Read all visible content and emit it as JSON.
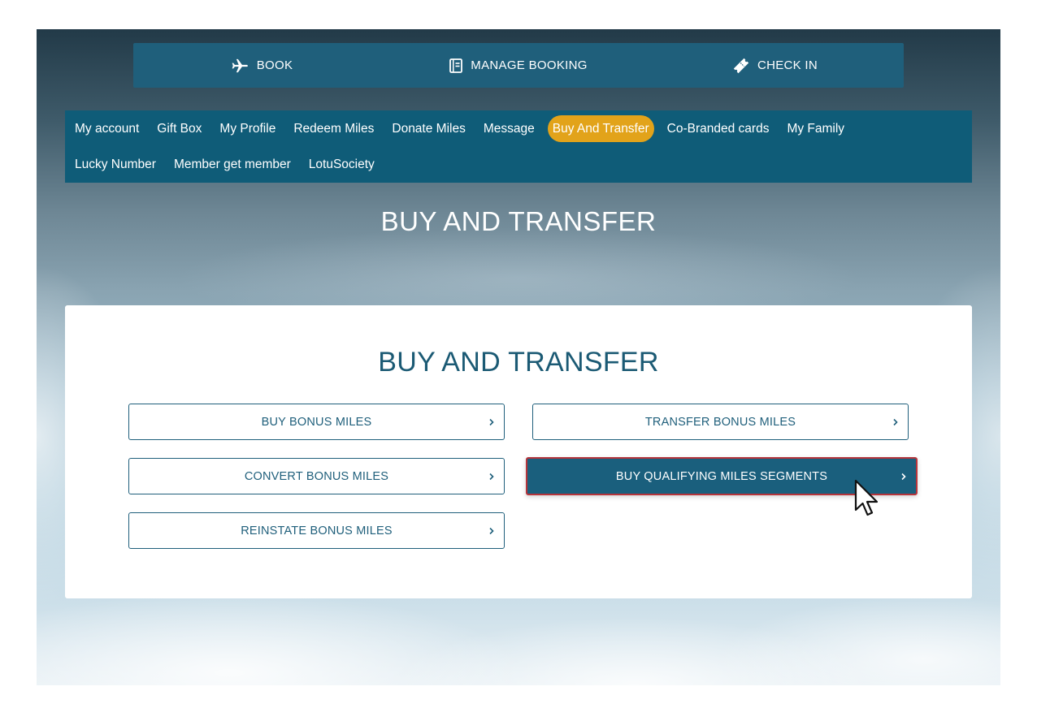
{
  "topbar": {
    "items": [
      {
        "label": "BOOK",
        "icon": "airplane-icon"
      },
      {
        "label": "MANAGE BOOKING",
        "icon": "booking-document-icon"
      },
      {
        "label": "CHECK IN",
        "icon": "ticket-icon"
      }
    ]
  },
  "member_nav": {
    "items": [
      "My account",
      "Gift Box",
      "My Profile",
      "Redeem Miles",
      "Donate Miles",
      "Message",
      "Buy And Transfer",
      "Co-Branded cards",
      "My Family",
      "Lucky Number",
      "Member get member",
      "LotuSociety"
    ],
    "active": "Buy And Transfer",
    "active_color": "#e2a31a"
  },
  "hero_title": "BUY AND TRANSFER",
  "card": {
    "title": "BUY AND TRANSFER",
    "options": [
      "BUY BONUS MILES",
      "TRANSFER BONUS MILES",
      "CONVERT BONUS MILES",
      "BUY QUALIFYING MILES SEGMENTS",
      "REINSTATE BONUS MILES"
    ],
    "highlighted": "BUY QUALIFYING MILES SEGMENTS"
  },
  "colors": {
    "primary": "#1f5f7b",
    "nav_bg": "#0f5c78",
    "highlight_border": "#b5343b"
  },
  "icons": {
    "chevron": "chevron-right-icon",
    "cursor": "mouse-pointer-icon"
  }
}
